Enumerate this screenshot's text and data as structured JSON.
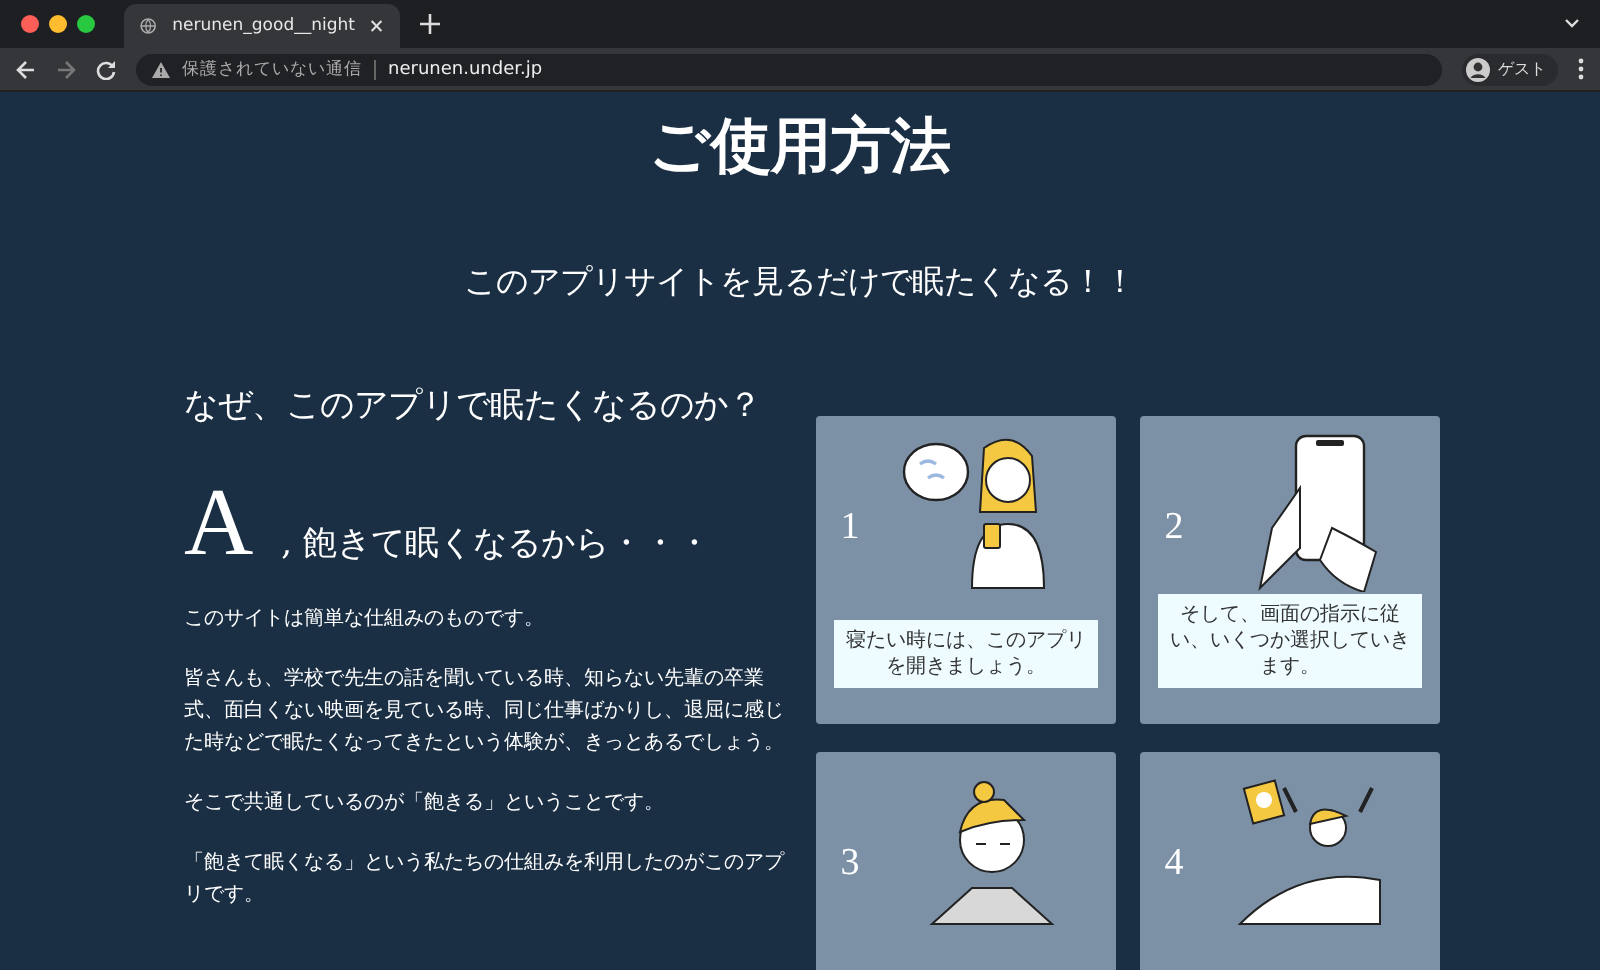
{
  "browser": {
    "tab_title": "nerunen_good__night",
    "security_label": "保護されていない通信",
    "url": "nerunen.under.jp",
    "profile_label": "ゲスト"
  },
  "page": {
    "title": "ご使用方法",
    "subtitle": "このアプリサイトを見るだけで眠たくなる！！",
    "question": "なぜ、このアプリで眠たくなるのか？",
    "answer_letter": "A",
    "answer_text": ", 飽きて眠くなるから・・・",
    "paragraphs": [
      "このサイトは簡単な仕組みのものです。",
      "皆さんも、学校で先生の話を聞いている時、知らない先輩の卒業式、面白くない映画を見ている時、同じ仕事ばかりし、退屈に感じた時などで眠たくなってきたという体験が、きっとあるでしょう。",
      "そこで共通しているのが「飽きる」ということです。",
      "「飽きて眠くなる」という私たちの仕組みを利用したのがこのアプリです。"
    ]
  },
  "steps": [
    {
      "number": "1",
      "kind": "phone-user",
      "caption": "寝たい時には、このアプリを開きましょう。"
    },
    {
      "number": "2",
      "kind": "hand-phone",
      "caption": "そして、画面の指示に従い、いくつか選択していきます。"
    },
    {
      "number": "3",
      "kind": "sleepy"
    },
    {
      "number": "4",
      "kind": "waking"
    }
  ]
}
